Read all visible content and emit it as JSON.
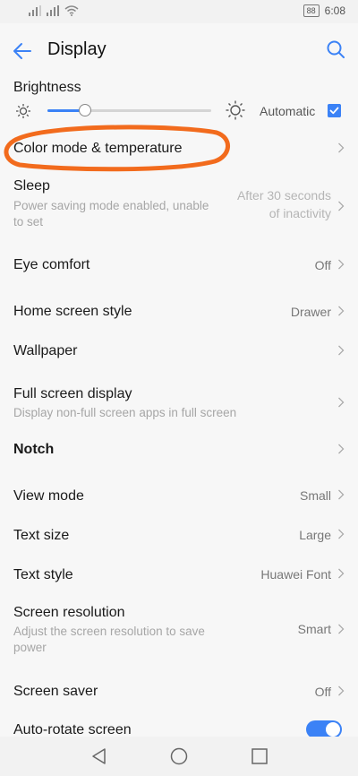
{
  "status": {
    "battery": "88",
    "time": "6:08"
  },
  "header": {
    "title": "Display"
  },
  "brightness": {
    "title": "Brightness",
    "auto_label": "Automatic",
    "level": 0.23,
    "auto_checked": true
  },
  "rows": [
    {
      "title": "Color mode & temperature",
      "subtitle": "",
      "value": ""
    },
    {
      "title": "Sleep",
      "subtitle_lines": [
        "Power saving mode enabled, unable",
        "to set"
      ],
      "value_lines": [
        "After 30 seconds",
        "of inactivity"
      ]
    },
    {
      "title": "Eye comfort",
      "value": "Off"
    },
    {
      "title": "Home screen style",
      "value": "Drawer"
    },
    {
      "title": "Wallpaper",
      "value": ""
    },
    {
      "title": "Full screen display",
      "subtitle": "Display non-full screen apps in full screen",
      "value": ""
    },
    {
      "title": "Notch",
      "value": ""
    },
    {
      "title": "View mode",
      "value": "Small"
    },
    {
      "title": "Text size",
      "value": "Large"
    },
    {
      "title": "Text style",
      "value": "Huawei Font"
    },
    {
      "title": "Screen resolution",
      "subtitle_lines": [
        "Adjust the screen resolution to save",
        "power"
      ],
      "value": "Smart"
    },
    {
      "title": "Screen saver",
      "value": "Off"
    },
    {
      "title": "Auto-rotate screen",
      "toggle_on": true
    }
  ],
  "colors": {
    "accent": "#3b82f6",
    "highlight": "#f26b1d"
  },
  "icons": [
    "back-arrow-icon",
    "search-icon",
    "sun-icon",
    "chevron-right-icon",
    "nav-back-icon",
    "nav-home-icon",
    "nav-recent-icon"
  ]
}
